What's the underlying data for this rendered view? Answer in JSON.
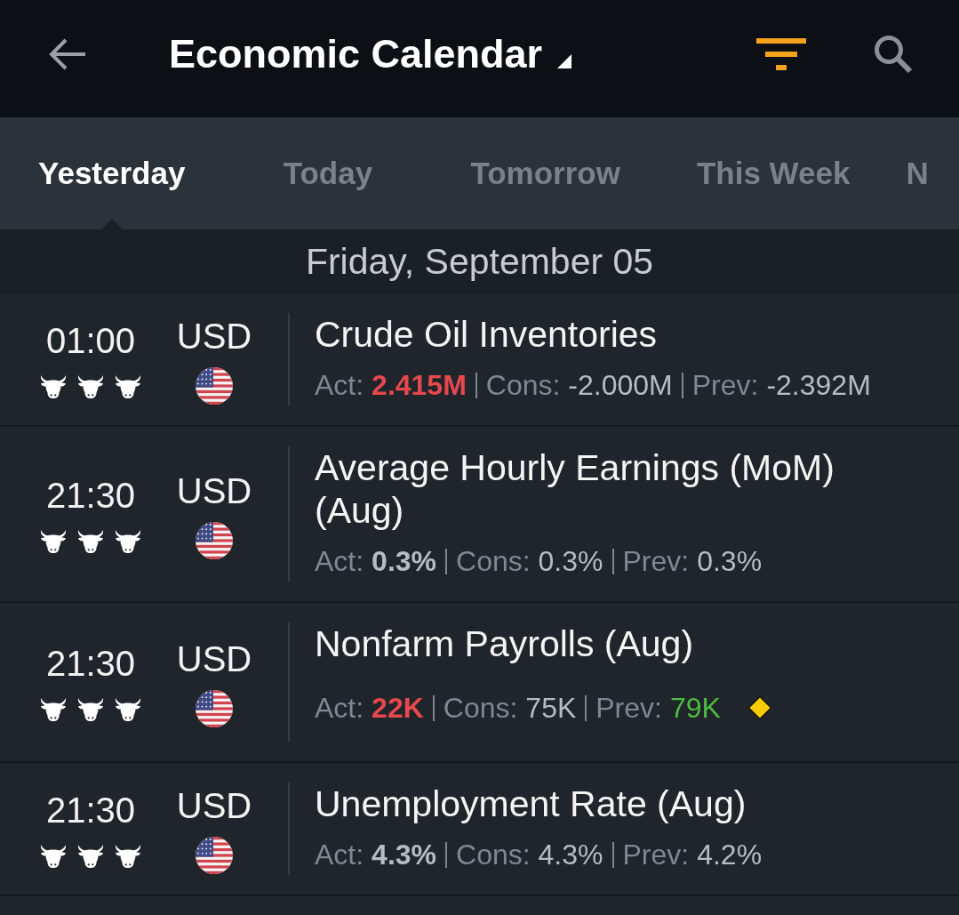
{
  "app_bar": {
    "title": "Economic Calendar"
  },
  "tabs": [
    {
      "label": "Yesterday",
      "selected": true
    },
    {
      "label": "Today",
      "selected": false
    },
    {
      "label": "Tomorrow",
      "selected": false
    },
    {
      "label": "This Week",
      "selected": false
    },
    {
      "label": "N",
      "selected": false
    }
  ],
  "date_header": "Friday, September 05",
  "events": [
    {
      "time": "01:00",
      "stars": 3,
      "currency": "USD",
      "title": "Crude Oil Inventories",
      "marked": false,
      "figures": [
        {
          "kind": "actual",
          "label": "Act:",
          "value": "2.415M",
          "color": "#e5484d"
        },
        {
          "kind": "consensus",
          "label": "Cons:",
          "value": "-2.000M",
          "color": "#b7bcc1"
        },
        {
          "kind": "previous",
          "label": "Prev:",
          "value": "-2.392M",
          "color": "#b7bcc1"
        }
      ]
    },
    {
      "time": "21:30",
      "stars": 3,
      "currency": "USD",
      "title": "Average Hourly Earnings (MoM) (Aug)",
      "marked": false,
      "figures": [
        {
          "kind": "actual",
          "label": "Act:",
          "value": "0.3%",
          "color": "#b7bcc1"
        },
        {
          "kind": "consensus",
          "label": "Cons:",
          "value": "0.3%",
          "color": "#b7bcc1"
        },
        {
          "kind": "previous",
          "label": "Prev:",
          "value": "0.3%",
          "color": "#b7bcc1"
        }
      ]
    },
    {
      "time": "21:30",
      "stars": 3,
      "currency": "USD",
      "title": "Nonfarm Payrolls (Aug)",
      "marked": true,
      "figures": [
        {
          "kind": "actual",
          "label": "Act:",
          "value": "22K",
          "color": "#e5484d"
        },
        {
          "kind": "consensus",
          "label": "Cons:",
          "value": "75K",
          "color": "#b7bcc1"
        },
        {
          "kind": "previous",
          "label": "Prev:",
          "value": "79K",
          "color": "#4cbb3f"
        }
      ]
    },
    {
      "time": "21:30",
      "stars": 3,
      "currency": "USD",
      "title": "Unemployment Rate (Aug)",
      "marked": false,
      "figures": [
        {
          "kind": "actual",
          "label": "Act:",
          "value": "4.3%",
          "color": "#b7bcc1"
        },
        {
          "kind": "consensus",
          "label": "Cons:",
          "value": "4.3%",
          "color": "#b7bcc1"
        },
        {
          "kind": "previous",
          "label": "Prev:",
          "value": "4.2%",
          "color": "#b7bcc1"
        }
      ]
    }
  ]
}
